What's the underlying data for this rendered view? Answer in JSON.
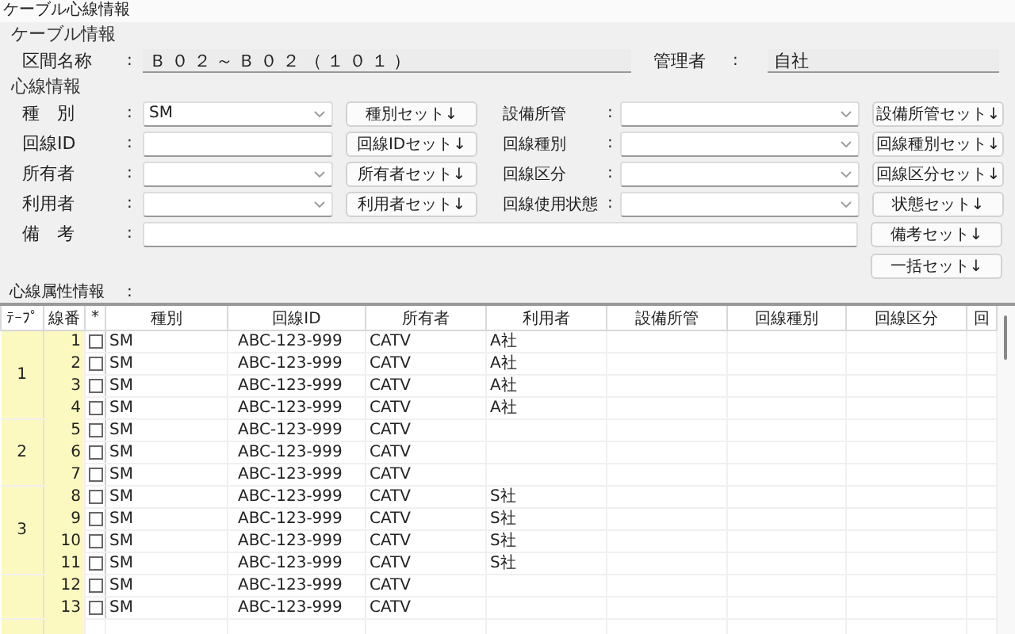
{
  "window": {
    "title": "ケーブル心線情報"
  },
  "cable_info": {
    "heading": "ケーブル情報",
    "section_name": {
      "label": "区間名称",
      "colon": ":",
      "value": "Ｂ０２～Ｂ０２（１０１）"
    },
    "manager": {
      "label": "管理者",
      "colon": ":",
      "value": "自社"
    }
  },
  "core_info": {
    "heading": "心線情報",
    "rows": [
      {
        "left": {
          "label": "種　別",
          "colon": ":",
          "kind": "dropdown",
          "value": "SM",
          "button": "種別セット↓"
        },
        "right": {
          "label": "設備所管",
          "colon": ":",
          "kind": "dropdown",
          "button": "設備所管セット↓"
        }
      },
      {
        "left": {
          "label": "回線ID",
          "colon": ":",
          "kind": "text",
          "button": "回線IDセット↓"
        },
        "right": {
          "label": "回線種別",
          "colon": ":",
          "kind": "dropdown",
          "button": "回線種別セット↓"
        }
      },
      {
        "left": {
          "label": "所有者",
          "colon": ":",
          "kind": "dropdown",
          "button": "所有者セット↓"
        },
        "right": {
          "label": "回線区分",
          "colon": ":",
          "kind": "dropdown",
          "button": "回線区分セット↓"
        }
      },
      {
        "left": {
          "label": "利用者",
          "colon": ":",
          "kind": "dropdown",
          "button": "利用者セット↓"
        },
        "right": {
          "label": "回線使用状態",
          "colon": ":",
          "kind": "dropdown",
          "button": "状態セット↓"
        }
      }
    ],
    "remarks": {
      "label": "備　考",
      "colon": ":",
      "button": "備考セット↓"
    },
    "bulk_button": "一括セット↓"
  },
  "attributes": {
    "heading": "心線属性情報",
    "colon": ":",
    "columns": [
      "ﾃｰﾌﾟ",
      "線番",
      "*",
      "種別",
      "回線ID",
      "所有者",
      "利用者",
      "設備所管",
      "回線種別",
      "回線区分",
      "回"
    ],
    "tapes": [
      {
        "label": "1",
        "rows": [
          {
            "no": "1",
            "checked": false,
            "type": "SM",
            "line_id": "ABC-123-999",
            "owner": "CATV",
            "user": "A社"
          },
          {
            "no": "2",
            "checked": false,
            "type": "SM",
            "line_id": "ABC-123-999",
            "owner": "CATV",
            "user": "A社"
          },
          {
            "no": "3",
            "checked": false,
            "type": "SM",
            "line_id": "ABC-123-999",
            "owner": "CATV",
            "user": "A社"
          },
          {
            "no": "4",
            "checked": false,
            "type": "SM",
            "line_id": "ABC-123-999",
            "owner": "CATV",
            "user": "A社"
          }
        ]
      },
      {
        "label": "2",
        "rows": [
          {
            "no": "5",
            "checked": false,
            "type": "SM",
            "line_id": "ABC-123-999",
            "owner": "CATV"
          },
          {
            "no": "6",
            "checked": false,
            "type": "SM",
            "line_id": "ABC-123-999",
            "owner": "CATV"
          },
          {
            "no": "7",
            "checked": false,
            "type": "SM",
            "line_id": "ABC-123-999",
            "owner": "CATV"
          }
        ]
      },
      {
        "label": "3",
        "rows": [
          {
            "no": "8",
            "checked": false,
            "type": "SM",
            "line_id": "ABC-123-999",
            "owner": "CATV",
            "user": "S社"
          },
          {
            "no": "9",
            "checked": false,
            "type": "SM",
            "line_id": "ABC-123-999",
            "owner": "CATV",
            "user": "S社"
          },
          {
            "no": "10",
            "checked": false,
            "type": "SM",
            "line_id": "ABC-123-999",
            "owner": "CATV",
            "user": "S社"
          },
          {
            "no": "11",
            "checked": false,
            "type": "SM",
            "line_id": "ABC-123-999",
            "owner": "CATV",
            "user": "S社"
          }
        ]
      },
      {
        "rows": [
          {
            "no": "12",
            "checked": false,
            "type": "SM",
            "line_id": "ABC-123-999",
            "owner": "CATV"
          },
          {
            "no": "13",
            "checked": false,
            "type": "SM",
            "line_id": "ABC-123-999",
            "owner": "CATV"
          }
        ]
      }
    ]
  }
}
